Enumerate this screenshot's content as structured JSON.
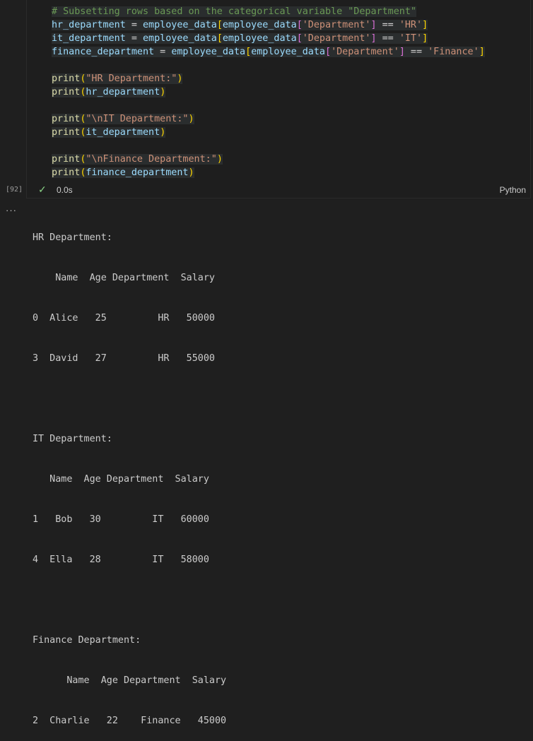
{
  "cell": {
    "execution_count": "[92]",
    "status_time": "0.0s",
    "language": "Python",
    "code": {
      "l1": "# Subsetting rows based on the categorical variable \"Department\"",
      "l2_var": "hr_department",
      "l2_val": "'HR'",
      "l3_var": "it_department",
      "l3_val": "'IT'",
      "l4_var": "finance_department",
      "l4_val": "'Finance'",
      "df": "employee_data",
      "col": "'Department'",
      "eq": " = ",
      "cmp": " == ",
      "print_fn": "print",
      "s1": "\"HR Department:\"",
      "s2": "\"\\nIT Department:\"",
      "s3": "\"\\nFinance Department:\""
    }
  },
  "output": {
    "more_label": "···",
    "lines": [
      "HR Department:",
      "    Name  Age Department  Salary",
      "0  Alice   25         HR   50000",
      "3  David   27         HR   55000",
      "",
      "IT Department:",
      "   Name  Age Department  Salary",
      "1   Bob   30         IT   60000",
      "4  Ella   28         IT   58000",
      "",
      "Finance Department:",
      "      Name  Age Department  Salary",
      "2  Charlie   22    Finance   45000"
    ]
  }
}
